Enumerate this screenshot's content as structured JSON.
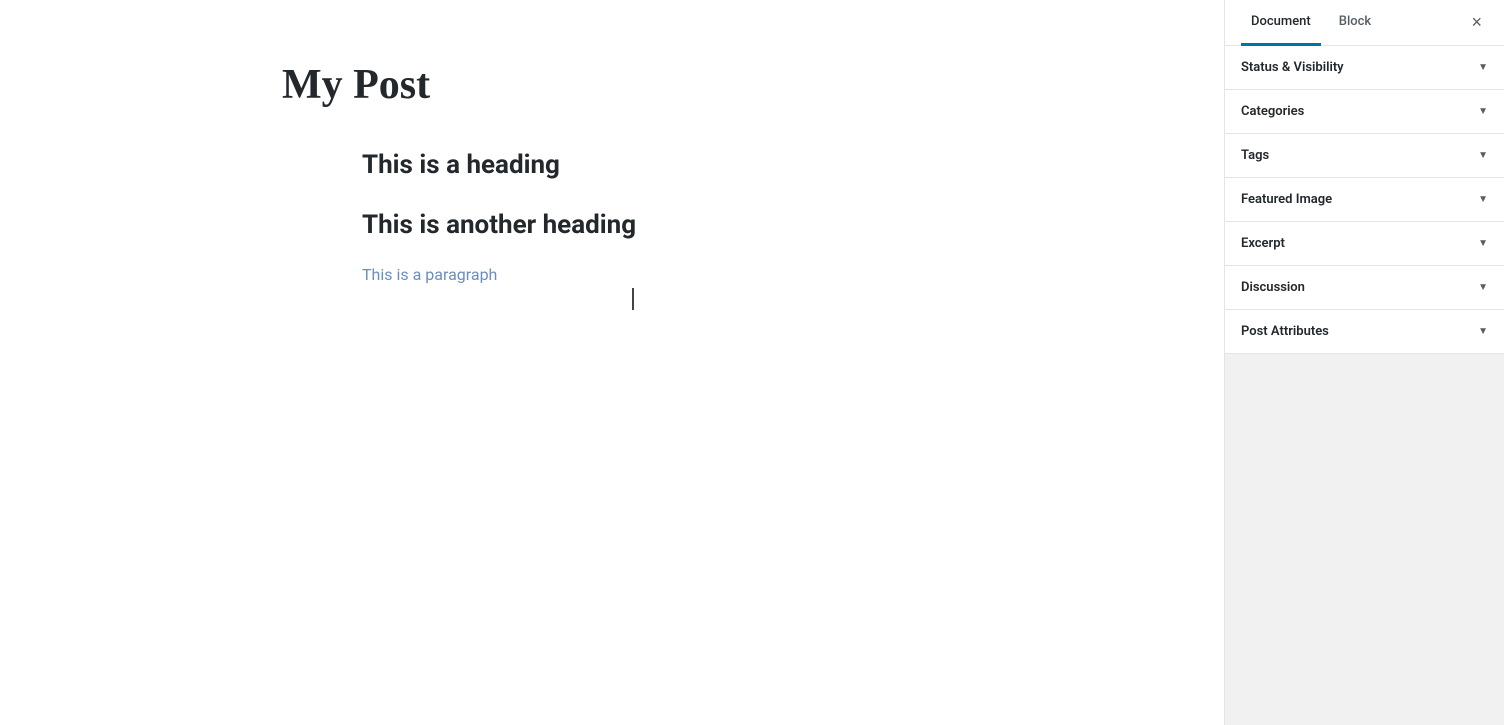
{
  "editor": {
    "post_title": "My Post",
    "heading1": "This is a heading",
    "heading2": "This is another heading",
    "paragraph": "This is a paragraph"
  },
  "sidebar": {
    "tab_document": "Document",
    "tab_block": "Block",
    "close_label": "×",
    "sections": [
      {
        "id": "status-visibility",
        "label": "Status & Visibility"
      },
      {
        "id": "categories",
        "label": "Categories"
      },
      {
        "id": "tags",
        "label": "Tags"
      },
      {
        "id": "featured-image",
        "label": "Featured Image"
      },
      {
        "id": "excerpt",
        "label": "Excerpt"
      },
      {
        "id": "discussion",
        "label": "Discussion"
      },
      {
        "id": "post-attributes",
        "label": "Post Attributes"
      }
    ]
  }
}
